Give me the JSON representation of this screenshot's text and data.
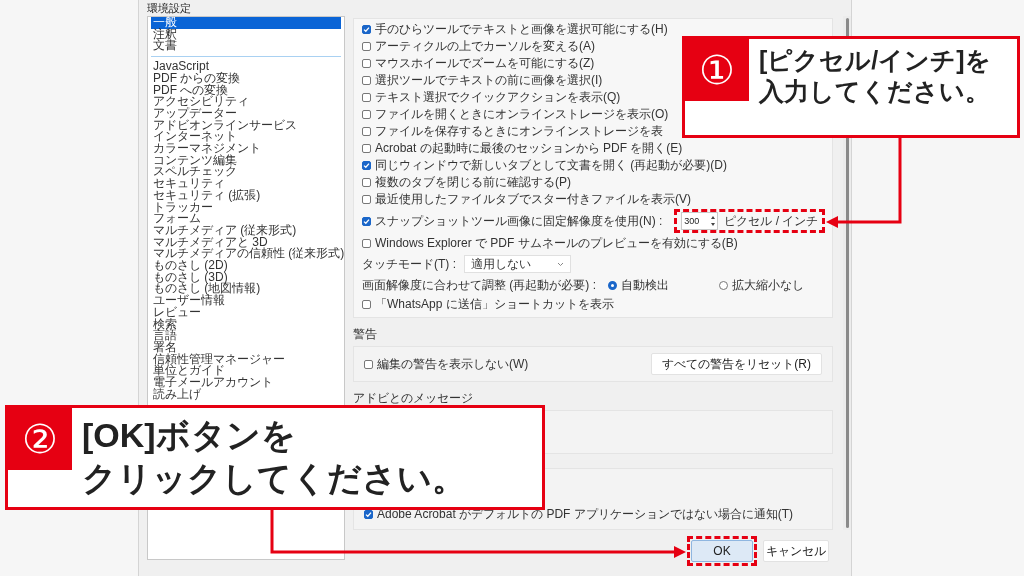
{
  "window": {
    "title": "環境設定"
  },
  "sidebar": {
    "groups": [
      [
        {
          "label": "一般",
          "selected": true
        },
        {
          "label": "注釈",
          "selected": false
        },
        {
          "label": "文書",
          "selected": false
        }
      ],
      [
        {
          "label": "JavaScript",
          "selected": false
        },
        {
          "label": "PDF からの変換",
          "selected": false
        },
        {
          "label": "PDF への変換",
          "selected": false
        },
        {
          "label": "アクセシビリティ",
          "selected": false
        },
        {
          "label": "アップデーター",
          "selected": false
        },
        {
          "label": "アドビオンラインサービス",
          "selected": false
        },
        {
          "label": "インターネット",
          "selected": false
        },
        {
          "label": "カラーマネジメント",
          "selected": false
        },
        {
          "label": "コンテンツ編集",
          "selected": false
        },
        {
          "label": "スペルチェック",
          "selected": false
        },
        {
          "label": "セキュリティ",
          "selected": false
        },
        {
          "label": "セキュリティ (拡張)",
          "selected": false
        },
        {
          "label": "トラッカー",
          "selected": false
        },
        {
          "label": "フォーム",
          "selected": false
        },
        {
          "label": "マルチメディア (従来形式)",
          "selected": false
        },
        {
          "label": "マルチメディアと 3D",
          "selected": false
        },
        {
          "label": "マルチメディアの信頼性 (従来形式)",
          "selected": false
        },
        {
          "label": "ものさし (2D)",
          "selected": false
        },
        {
          "label": "ものさし (3D)",
          "selected": false
        },
        {
          "label": "ものさし (地図情報)",
          "selected": false
        },
        {
          "label": "ユーザー情報",
          "selected": false
        },
        {
          "label": "レビュー",
          "selected": false
        },
        {
          "label": "検索",
          "selected": false
        },
        {
          "label": "言語",
          "selected": false
        },
        {
          "label": "署名",
          "selected": false
        },
        {
          "label": "信頼性管理マネージャー",
          "selected": false
        },
        {
          "label": "単位とガイド",
          "selected": false
        },
        {
          "label": "電子メールアカウント",
          "selected": false
        },
        {
          "label": "読み上げ",
          "selected": false
        }
      ]
    ]
  },
  "general": {
    "rows": [
      {
        "kind": "checkbox",
        "label": "手のひらツールでテキストと画像を選択可能にする(H)",
        "checked": true
      },
      {
        "kind": "checkbox",
        "label": "アーティクルの上でカーソルを変える(A)",
        "checked": false
      },
      {
        "kind": "checkbox",
        "label": "マウスホイールでズームを可能にする(Z)",
        "checked": false
      },
      {
        "kind": "checkbox",
        "label": "選択ツールでテキストの前に画像を選択(I)",
        "checked": false
      },
      {
        "kind": "checkbox",
        "label": "テキスト選択でクイックアクションを表示(Q)",
        "checked": false
      },
      {
        "kind": "checkbox",
        "label": "ファイルを開くときにオンラインストレージを表示(O)",
        "checked": false
      },
      {
        "kind": "checkbox",
        "label": "ファイルを保存するときにオンラインストレージを表",
        "checked": false
      },
      {
        "kind": "checkbox",
        "label": "Acrobat の起動時に最後のセッションから PDF を開く(E)",
        "checked": false
      },
      {
        "kind": "checkbox",
        "label": "同じウィンドウで新しいタブとして文書を開く (再起動が必要)(D)",
        "checked": true
      },
      {
        "kind": "checkbox",
        "label": "複数のタブを閉じる前に確認する(P)",
        "checked": false
      },
      {
        "kind": "checkbox",
        "label": "最近使用したファイルタブでスター付きファイルを表示(V)",
        "checked": false
      },
      {
        "kind": "spin",
        "label": "スナップショットツール画像に固定解像度を使用(N) :",
        "checked": true,
        "value": "300",
        "unit": "ピクセル / インチ"
      },
      {
        "kind": "checkbox",
        "label": "Windows Explorer で PDF サムネールのプレビューを有効にする(B)",
        "checked": false
      },
      {
        "kind": "select",
        "label": "タッチモード(T) :",
        "value": "適用しない"
      },
      {
        "kind": "radio",
        "label": "画面解像度に合わせて調整 (再起動が必要) :",
        "options": [
          {
            "label": "自動検出",
            "selected": true
          },
          {
            "label": "拡大縮小なし",
            "selected": false
          }
        ]
      },
      {
        "kind": "checkbox",
        "label": "「WhatsApp に送信」ショートカットを表示",
        "checked": false
      }
    ]
  },
  "warnings": {
    "title": "警告",
    "option": {
      "label": "編集の警告を表示しない(W)",
      "checked": false
    },
    "button": "すべての警告をリセット(R)"
  },
  "adobe_messages": {
    "title": "アドビとのメッセージ"
  },
  "app_startup": {
    "option": {
      "label": "Adobe Acrobat がデフォルトの PDF アプリケーションではない場合に通知(T)",
      "checked": true
    }
  },
  "footer": {
    "buttons": [
      {
        "label": "OK",
        "default": true
      },
      {
        "label": "キャンセル",
        "default": false
      }
    ]
  },
  "callouts": [
    {
      "number": "①",
      "lines": [
        "[ピクセル/インチ]を",
        "入力してください。"
      ]
    },
    {
      "number": "②",
      "lines": [
        "[OK]ボタンを",
        "クリックしてください。"
      ]
    }
  ]
}
